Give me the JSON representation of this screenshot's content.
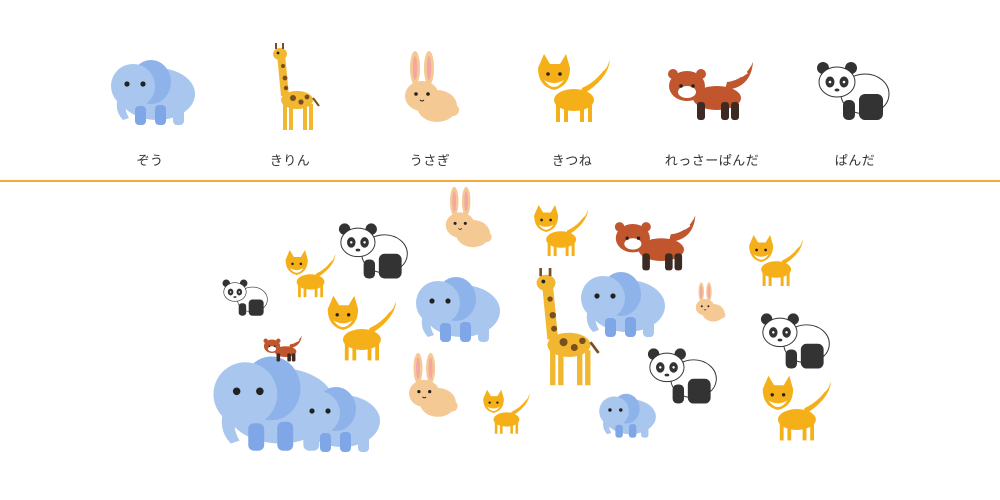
{
  "colors": {
    "divider": "#f4a93a",
    "elephant_body": "#a9c6ef",
    "elephant_ear": "#8eb3ea",
    "elephant_leg": "#7fa6e6",
    "giraffe_body": "#f2b731",
    "giraffe_spot": "#7a4f1e",
    "rabbit_body": "#f5c993",
    "rabbit_inner_ear": "#f3a7a0",
    "fox_body": "#f5b019",
    "fox_white": "#ffffff",
    "redpanda_body": "#c0552e",
    "redpanda_dark": "#3d2a23",
    "panda_black": "#333333",
    "panda_white": "#ffffff"
  },
  "legend": [
    {
      "id": "elephant",
      "label": "ぞう",
      "icon": "elephant-icon"
    },
    {
      "id": "giraffe",
      "label": "きりん",
      "icon": "giraffe-icon"
    },
    {
      "id": "rabbit",
      "label": "うさぎ",
      "icon": "rabbit-icon"
    },
    {
      "id": "fox",
      "label": "きつね",
      "icon": "fox-icon"
    },
    {
      "id": "redpanda",
      "label": "れっさーぱんだ",
      "icon": "red-panda-icon"
    },
    {
      "id": "panda",
      "label": "ぱんだ",
      "icon": "panda-icon"
    }
  ],
  "field_counts": {
    "elephant": 5,
    "giraffe": 1,
    "rabbit": 3,
    "fox": 6,
    "redpanda": 2,
    "panda": 4
  }
}
